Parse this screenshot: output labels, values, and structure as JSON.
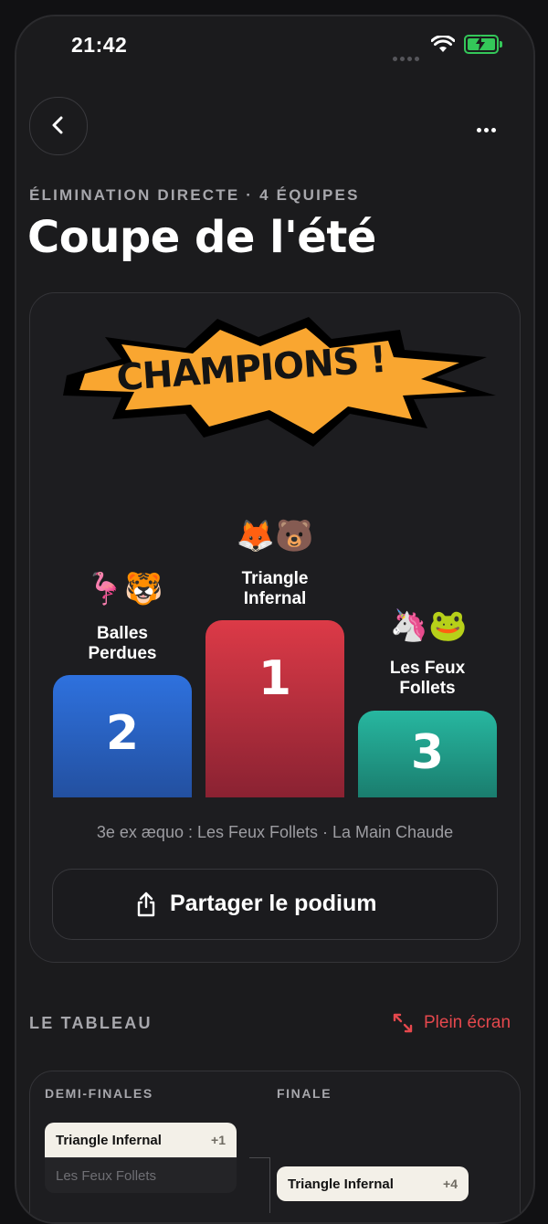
{
  "status_bar": {
    "time": "21:42"
  },
  "header": {
    "subtitle": "ÉLIMINATION DIRECTE · 4 ÉQUIPES",
    "title": "Coupe de l'été"
  },
  "podium": {
    "banner": "CHAMPIONS !",
    "first": {
      "rank": "1",
      "name_line1": "Triangle",
      "name_line2": "Infernal",
      "emojis": "🦊🐻"
    },
    "second": {
      "rank": "2",
      "name_line1": "Balles",
      "name_line2": "Perdues",
      "emojis": "🦩🐯"
    },
    "third": {
      "rank": "3",
      "name_line1": "Les Feux",
      "name_line2": "Follets",
      "emojis": "🦄🐸"
    },
    "ex_aequo": "3e ex æquo : Les Feux Follets · La Main Chaude",
    "share_label": "Partager le podium"
  },
  "bracket": {
    "section_label": "LE TABLEAU",
    "fullscreen_label": "Plein écran",
    "rounds": [
      "DEMI-FINALES",
      "FINALE"
    ],
    "semi_match": [
      {
        "team": "Triangle Infernal",
        "score": "+1"
      },
      {
        "team": "Les Feux Follets",
        "score": ""
      }
    ],
    "final_match": [
      {
        "team": "Triangle Infernal",
        "score": "+4"
      }
    ]
  },
  "colors": {
    "background": "#1b1b1d",
    "accent_red": "#e5484d",
    "burst_orange": "#f9a630",
    "second_blue": "#2e71de",
    "first_red": "#dc3a47",
    "third_teal": "#27b7a0"
  }
}
